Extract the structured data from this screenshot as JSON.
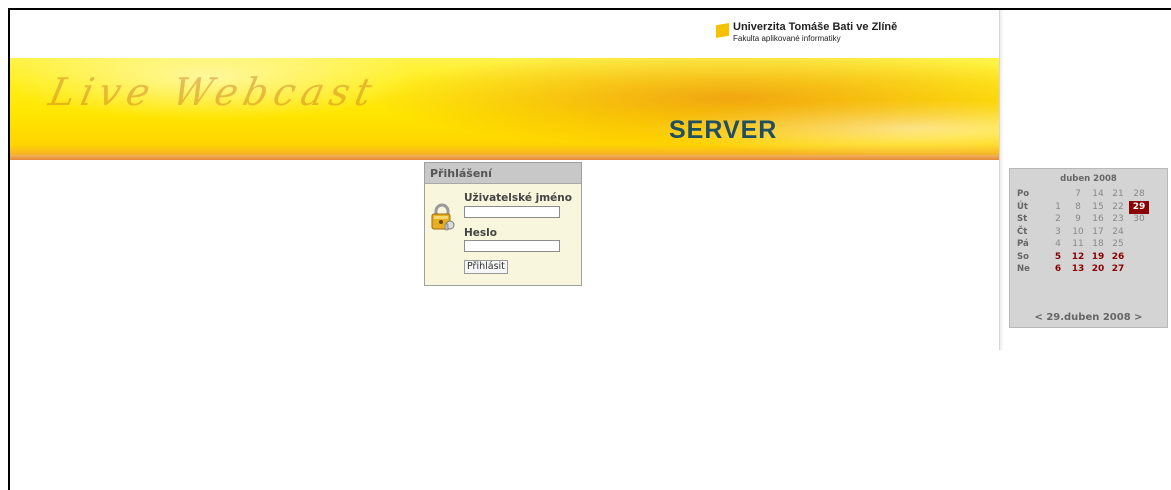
{
  "header": {
    "university": "Univerzita Tomáše Bati ve Zlíně",
    "faculty": "Fakulta aplikované informatiky",
    "banner_script": "Live Webcast",
    "banner_server": "SERVER"
  },
  "login": {
    "title": "Přihlášení",
    "username_label": "Uživatelské jméno",
    "username_value": "",
    "password_label": "Heslo",
    "password_value": "",
    "submit_label": "Přihlásit",
    "icon": "lock-icon"
  },
  "calendar": {
    "title": "duben 2008",
    "nav_label": "< 29.duben 2008 >",
    "today_color": "#8b0000",
    "rows": [
      {
        "day": "Po",
        "cells": [
          "",
          "7",
          "14",
          "21",
          "28"
        ],
        "weekend": false
      },
      {
        "day": "Út",
        "cells": [
          "1",
          "8",
          "15",
          "22",
          "29"
        ],
        "weekend": false
      },
      {
        "day": "St",
        "cells": [
          "2",
          "9",
          "16",
          "23",
          "30"
        ],
        "weekend": false
      },
      {
        "day": "Čt",
        "cells": [
          "3",
          "10",
          "17",
          "24",
          ""
        ],
        "weekend": false
      },
      {
        "day": "Pá",
        "cells": [
          "4",
          "11",
          "18",
          "25",
          ""
        ],
        "weekend": false
      },
      {
        "day": "So",
        "cells": [
          "5",
          "12",
          "19",
          "26",
          ""
        ],
        "weekend": true
      },
      {
        "day": "Ne",
        "cells": [
          "6",
          "13",
          "20",
          "27",
          ""
        ],
        "weekend": true
      }
    ],
    "today": "29"
  }
}
